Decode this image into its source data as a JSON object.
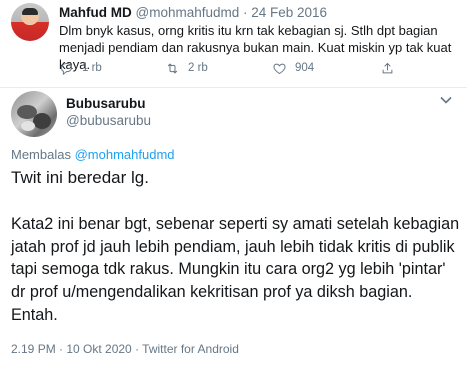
{
  "parent_tweet": {
    "name": "Mahfud MD",
    "meta": "@mohmahfudmd · 24 Feb 2016",
    "text": "Dlm bnyk kasus, orng kritis itu krn tak kebagian sj. Stlh dpt bagian menjadi pendiam dan rakusnya bukan main. Kuat miskin yp tak kuat kaya.",
    "actions": {
      "reply_count": "1 rb",
      "retweet_count": "2 rb",
      "like_count": "904"
    },
    "avatar": "avatar-photo"
  },
  "tweet": {
    "name": "Bubusarubu",
    "handle": "@bubusarubu",
    "reply_prefix": "Membalas",
    "reply_handle": "@mohmahfudmd",
    "line1": "Twit ini beredar lg.",
    "paragraph": "Kata2 ini benar bgt, sebenar seperti sy amati setelah kebagian jatah prof jd jauh lebih pendiam, jauh lebih tidak kritis di publik tapi semoga tdk rakus. Mungkin itu cara org2 yg lebih 'pintar' dr prof u/mengendalikan kekritisan prof ya diksh bagian. Entah.",
    "timestamp": "2.19 PM · 10 Okt 2020 · Twitter for Android"
  },
  "icons": {
    "reply": "reply-icon",
    "retweet": "retweet-icon",
    "like": "like-icon",
    "share": "share-icon",
    "more": "chevron-down-icon"
  },
  "colors": {
    "text": "#14171a",
    "muted": "#657786",
    "link": "#1da1f2",
    "divider": "#e6ecf0"
  }
}
